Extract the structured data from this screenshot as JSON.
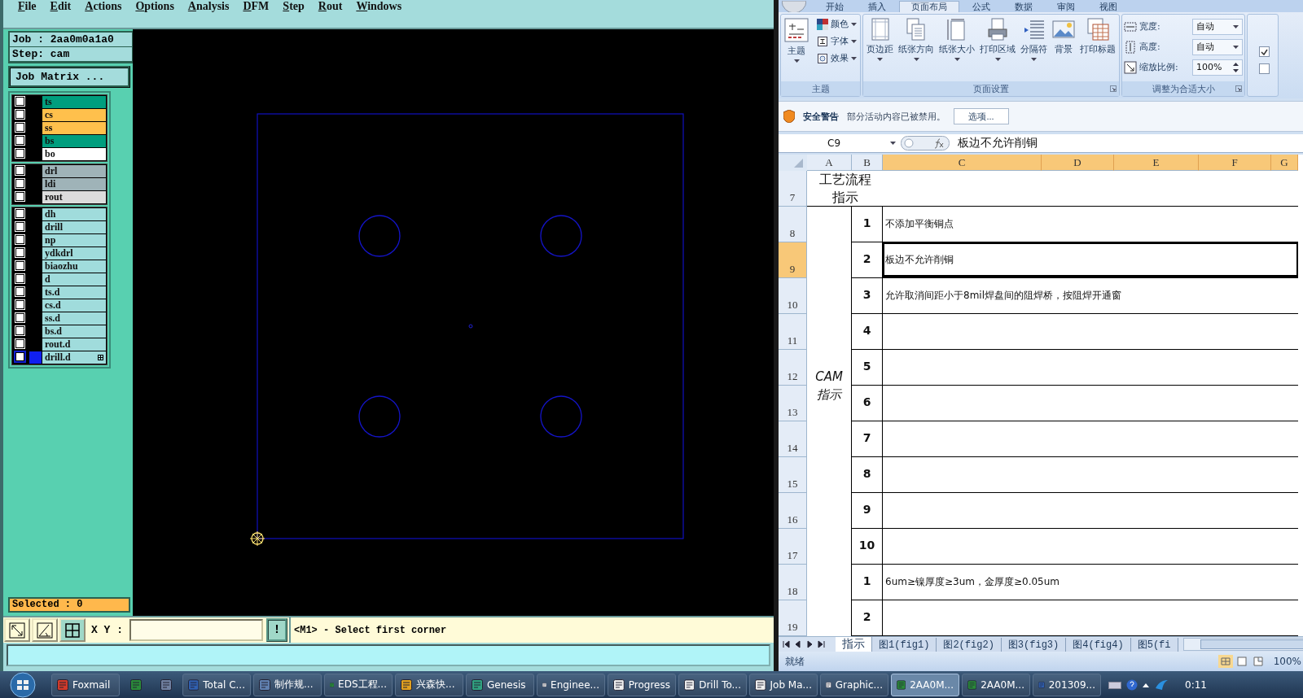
{
  "genesis": {
    "menu": [
      "File",
      "Edit",
      "Actions",
      "Options",
      "Analysis",
      "DFM",
      "Step",
      "Rout",
      "Windows"
    ],
    "job": "Job : 2aa0m0a1a0",
    "step": "Step: cam",
    "matrix_button": "Job Matrix ...",
    "layer_groups": [
      [
        {
          "name": "ts",
          "color": "#009e7e",
          "checked": false,
          "selected": false
        },
        {
          "name": "cs",
          "color": "#ffc04c",
          "checked": false,
          "selected": false
        },
        {
          "name": "ss",
          "color": "#ffc04c",
          "checked": false,
          "selected": false
        },
        {
          "name": "bs",
          "color": "#009e7e",
          "checked": false,
          "selected": false
        },
        {
          "name": "bo",
          "color": "#ffffff",
          "checked": false,
          "selected": false
        }
      ],
      [
        {
          "name": "drl",
          "color": "#9fb3b8",
          "checked": false,
          "selected": false
        },
        {
          "name": "ldi",
          "color": "#9fb3b8",
          "checked": false,
          "selected": false
        },
        {
          "name": "rout",
          "color": "#dcdcdc",
          "checked": false,
          "selected": false
        }
      ],
      [
        {
          "name": "dh",
          "color": "#a0dcdc",
          "checked": false,
          "selected": false
        },
        {
          "name": "drill",
          "color": "#a0dcdc",
          "checked": false,
          "selected": false
        },
        {
          "name": "np",
          "color": "#a0dcdc",
          "checked": false,
          "selected": false
        },
        {
          "name": "ydkdrl",
          "color": "#a0dcdc",
          "checked": false,
          "selected": false
        },
        {
          "name": "biaozhu",
          "color": "#a0dcdc",
          "checked": false,
          "selected": false
        },
        {
          "name": "d",
          "color": "#a0dcdc",
          "checked": false,
          "selected": false
        },
        {
          "name": "ts.d",
          "color": "#a0dcdc",
          "checked": false,
          "selected": false
        },
        {
          "name": "cs.d",
          "color": "#a0dcdc",
          "checked": false,
          "selected": false
        },
        {
          "name": "ss.d",
          "color": "#a0dcdc",
          "checked": false,
          "selected": false
        },
        {
          "name": "bs.d",
          "color": "#a0dcdc",
          "checked": false,
          "selected": false
        },
        {
          "name": "rout.d",
          "color": "#a0dcdc",
          "checked": false,
          "selected": false
        },
        {
          "name": "drill.d",
          "color": "#a0dcdc",
          "checked": false,
          "selected": true
        }
      ]
    ],
    "selected_count": "Selected : 0",
    "toolbar": {
      "xy_label": "X Y :",
      "alert_button": "!",
      "message": "<M1> - Select first corner"
    }
  },
  "excel": {
    "ribbon": {
      "tabs": [
        {
          "label": "开始",
          "selected": false
        },
        {
          "label": "插入",
          "selected": false
        },
        {
          "label": "页面布局",
          "selected": true
        },
        {
          "label": "公式",
          "selected": false
        },
        {
          "label": "数据",
          "selected": false
        },
        {
          "label": "审阅",
          "selected": false
        },
        {
          "label": "视图",
          "selected": false
        }
      ],
      "groups": [
        {
          "kind": "theme",
          "label": "主题",
          "big": {
            "label": "主题",
            "caret": true
          },
          "small": [
            {
              "label": "颜色",
              "caret": true
            },
            {
              "label": "字体",
              "caret": true
            },
            {
              "label": "效果",
              "caret": true
            }
          ]
        },
        {
          "kind": "buttons",
          "label": "页面设置",
          "buttons": [
            {
              "label": "页边距",
              "caret": true
            },
            {
              "label": "纸张方向",
              "caret": true
            },
            {
              "label": "纸张大小",
              "caret": true
            },
            {
              "label": "打印区域",
              "caret": true
            },
            {
              "label": "分隔符",
              "caret": true
            },
            {
              "label": "背景",
              "caret": false
            },
            {
              "label": "打印标题",
              "caret": false
            }
          ]
        },
        {
          "kind": "fields",
          "label": "调整为合适大小",
          "fields": [
            {
              "label": "宽度:",
              "value": "自动",
              "kind": "dropdown"
            },
            {
              "label": "高度:",
              "value": "自动",
              "kind": "dropdown"
            },
            {
              "label": "缩放比例:",
              "value": "100%",
              "kind": "spinner"
            }
          ]
        },
        {
          "kind": "checks",
          "checks": [
            {
              "checked": true
            },
            {
              "checked": false
            }
          ]
        }
      ]
    },
    "security": {
      "title": "安全警告",
      "message": "部分活动内容已被禁用。",
      "button": "选项..."
    },
    "formula_bar": {
      "cell": "C9",
      "value": "板边不允许削铜"
    },
    "columns": [
      {
        "label": "A",
        "selected": false
      },
      {
        "label": "B",
        "selected": false
      },
      {
        "label": "C",
        "selected": true
      },
      {
        "label": "D",
        "selected": true
      },
      {
        "label": "E",
        "selected": true
      },
      {
        "label": "F",
        "selected": true
      },
      {
        "label": "G",
        "selected": true
      }
    ],
    "rows": [
      {
        "label": "7",
        "selected": false
      },
      {
        "label": "8",
        "selected": false
      },
      {
        "label": "9",
        "selected": true
      },
      {
        "label": "10",
        "selected": false
      },
      {
        "label": "11",
        "selected": false
      },
      {
        "label": "12",
        "selected": false
      },
      {
        "label": "13",
        "selected": false
      },
      {
        "label": "14",
        "selected": false
      },
      {
        "label": "15",
        "selected": false
      },
      {
        "label": "16",
        "selected": false
      },
      {
        "label": "17",
        "selected": false
      },
      {
        "label": "18",
        "selected": false
      },
      {
        "label": "19",
        "selected": false
      }
    ],
    "sections": [
      {
        "kind": "header",
        "heading": "工艺流程指示"
      },
      {
        "kind": "numbered",
        "heading": "CAM 指示",
        "items": [
          {
            "number": "1",
            "text": "不添加平衡铜点",
            "selected": false
          },
          {
            "number": "2",
            "text": "板边不允许削铜",
            "selected": true
          },
          {
            "number": "3",
            "text": "允许取消间距小于8mil焊盘间的阻焊桥，按阻焊开通窗",
            "selected": false
          },
          {
            "number": "4",
            "selected": false
          },
          {
            "number": "5",
            "selected": false
          },
          {
            "number": "6",
            "selected": false
          },
          {
            "number": "7",
            "selected": false
          },
          {
            "number": "8",
            "selected": false
          },
          {
            "number": "9",
            "selected": false
          },
          {
            "number": "10",
            "selected": false
          }
        ]
      },
      {
        "kind": "numbered",
        "items": [
          {
            "number": "1",
            "text": "6um≥镍厚度≥3um，金厚度≥0.05um",
            "selected": false
          },
          {
            "number": "2",
            "selected": false
          }
        ]
      }
    ],
    "sheet_tabs": [
      {
        "label": "指示",
        "selected": true
      },
      {
        "label": "图1(fig1)",
        "selected": false
      },
      {
        "label": "图2(fig2)",
        "selected": false
      },
      {
        "label": "图3(fig3)",
        "selected": false
      },
      {
        "label": "图4(fig4)",
        "selected": false
      },
      {
        "label": "图5(fi",
        "selected": false
      }
    ],
    "status": {
      "text": "就绪",
      "zoom": "100%"
    }
  },
  "taskbar": {
    "items": [
      {
        "kind": "labeled",
        "label": "Foxmail",
        "selected": false
      },
      {
        "kind": "icon",
        "selected": false
      },
      {
        "kind": "icon",
        "selected": false
      },
      {
        "kind": "labeled",
        "label": "Total C...",
        "selected": false
      },
      {
        "kind": "labeled",
        "label": "制作规...",
        "selected": false
      },
      {
        "kind": "labeled",
        "label": "EDS工程...",
        "selected": false
      },
      {
        "kind": "labeled",
        "label": "兴森快...",
        "selected": false
      },
      {
        "kind": "labeled",
        "label": "Genesis",
        "selected": false
      },
      {
        "kind": "labeled",
        "label": "Enginee...",
        "selected": false
      },
      {
        "kind": "labeled",
        "label": "Progress",
        "selected": false
      },
      {
        "kind": "labeled",
        "label": "Drill To...",
        "selected": false
      },
      {
        "kind": "labeled",
        "label": "Job Ma...",
        "selected": false
      },
      {
        "kind": "labeled",
        "label": "Graphic...",
        "selected": false
      },
      {
        "kind": "labeled",
        "label": "2AA0M...",
        "selected": true
      },
      {
        "kind": "labeled",
        "label": "2AA0M...",
        "selected": false
      },
      {
        "kind": "labeled",
        "label": "201309...",
        "selected": false
      }
    ],
    "clock": "0:11"
  }
}
